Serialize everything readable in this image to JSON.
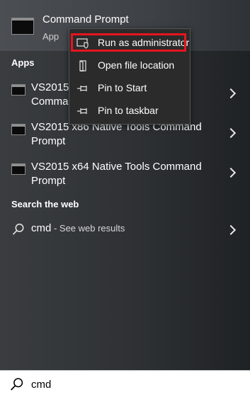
{
  "top_result": {
    "title": "Command Prompt",
    "subtitle": "App",
    "icon": "command-prompt-icon"
  },
  "apps_section": {
    "header": "Apps",
    "items": [
      {
        "label": "VS2015 x64 x86 Cross Tools Command Prompt",
        "icon": "console-app-icon"
      },
      {
        "label": "VS2015 x86 Native Tools Command Prompt",
        "icon": "console-app-icon"
      },
      {
        "label": "VS2015 x64 Native Tools Command Prompt",
        "icon": "console-app-icon"
      }
    ]
  },
  "web_section": {
    "header": "Search the web",
    "query": "cmd",
    "hint": " - See web results"
  },
  "context_menu": {
    "items": [
      {
        "label": "Run as administrator",
        "icon": "shield-icon",
        "highlighted": true
      },
      {
        "label": "Open file location",
        "icon": "folder-location-icon"
      },
      {
        "label": "Pin to Start",
        "icon": "pin-icon"
      },
      {
        "label": "Pin to taskbar",
        "icon": "pin-icon"
      }
    ]
  },
  "search_box": {
    "value": "cmd",
    "icon": "search-icon"
  },
  "colors": {
    "highlight_border": "#e8141f",
    "panel_bg": "#2e3134"
  }
}
